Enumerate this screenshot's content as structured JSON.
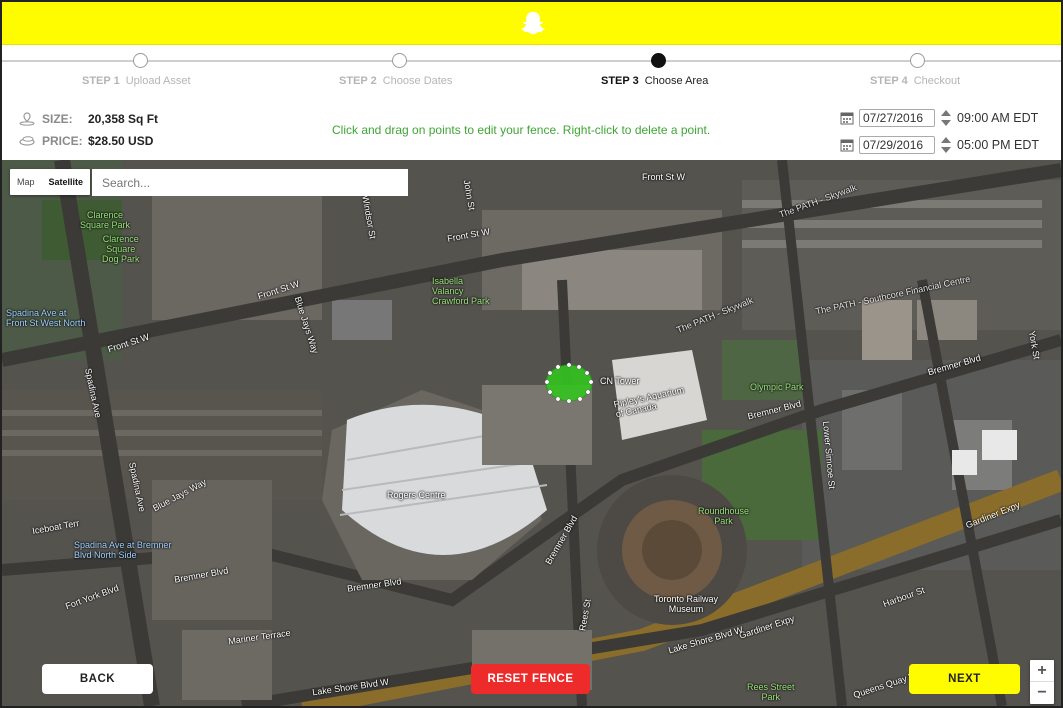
{
  "header": {
    "logo": "snapchat-ghost"
  },
  "steps": [
    {
      "num": "STEP 1",
      "label": "Upload Asset",
      "state": "done"
    },
    {
      "num": "STEP 2",
      "label": "Choose Dates",
      "state": "done"
    },
    {
      "num": "STEP 3",
      "label": "Choose Area",
      "state": "current"
    },
    {
      "num": "STEP 4",
      "label": "Checkout",
      "state": "todo"
    }
  ],
  "info": {
    "size_label": "SIZE:",
    "size_value": "20,358 Sq Ft",
    "price_label": "PRICE:",
    "price_value": "$28.50 USD",
    "instruction": "Click and drag on points to edit your fence. Right-click to delete a point."
  },
  "schedule": {
    "start_date": "07/27/2016",
    "start_time": "09:00 AM EDT",
    "end_date": "07/29/2016",
    "end_time": "05:00 PM EDT"
  },
  "map": {
    "type_map": "Map",
    "type_satellite": "Satellite",
    "search_placeholder": "Search...",
    "labels": {
      "front_st_w_1": "Front St W",
      "front_st_w_2": "Front St W",
      "front_st_w_3": "Front St W",
      "front_st_w_4": "Front St W",
      "clarence": "Clarence\nSquare Park",
      "clarence_dog": "Clarence\nSquare\nDog Park",
      "isabella": "Isabella\nValancy\nCrawford Park",
      "path_skywalk_1": "The PATH - Skywalk",
      "path_skywalk_2": "The PATH - Skywalk",
      "path_southcore": "The PATH - Southcore Financial Centre",
      "cn_tower": "CN Tower",
      "ripleys": "Ripley's Aquarium\nof Canada",
      "olympic": "Olympic Park",
      "rogers": "Rogers Centre",
      "bremner_1": "Bremner Blvd",
      "bremner_2": "Bremner Blvd",
      "bremner_3": "Bremner Blvd",
      "bremner_4": "Bremner Blvd",
      "bremner_5": "Bremner Blvd",
      "blue_jays_1": "Blue Jays Way",
      "blue_jays_2": "Blue Jays Way",
      "spadina_1": "Spadina Ave",
      "spadina_2": "Spadina Ave",
      "spadina_front": "Spadina Ave at\nFront St West North",
      "spadina_bremner": "Spadina Ave at Bremner\nBlvd North Side",
      "iceboat": "Iceboat Terr",
      "fort_york": "Fort York Blvd",
      "mariner": "Mariner Terrace",
      "roundhouse": "Roundhouse\nPark",
      "railway": "Toronto Railway\nMuseum",
      "lower_simcoe": "Lower Simcoe St",
      "york": "York St",
      "gardiner_1": "Gardiner Expy",
      "gardiner_2": "Gardiner Expy",
      "lake_shore_1": "Lake Shore Blvd W",
      "lake_shore_2": "Lake Shore Blvd W",
      "harbour": "Harbour St",
      "queens_quay": "Queens Quay W",
      "rees": "Rees Street\nPark",
      "rees_st": "Rees St",
      "windsor": "Windsor St",
      "john": "John St"
    }
  },
  "buttons": {
    "back": "BACK",
    "reset": "RESET FENCE",
    "next": "NEXT",
    "zoom_in": "+",
    "zoom_out": "−"
  },
  "colors": {
    "brand_yellow": "#fffc00",
    "reset_red": "#ee2b2b",
    "instruction_green": "#3fa535",
    "fence_green": "#33c41f"
  }
}
